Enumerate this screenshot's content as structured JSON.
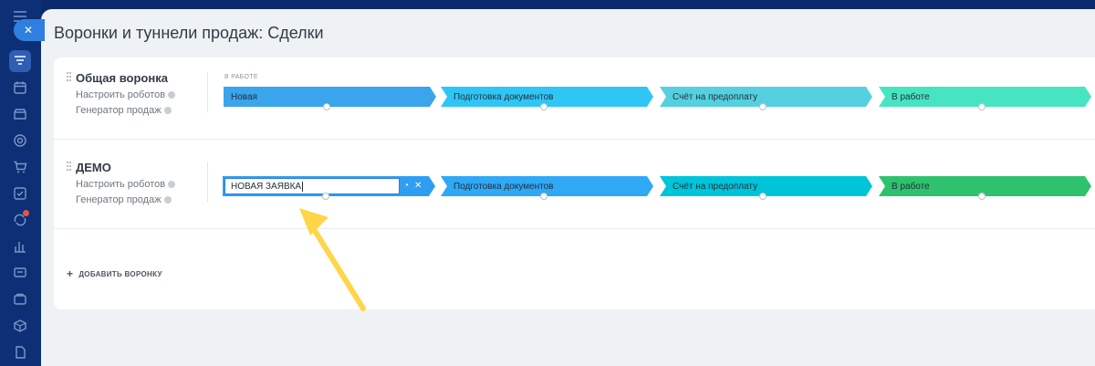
{
  "page": {
    "title": "Воронки и туннели продаж: Сделки"
  },
  "sidebar": {
    "items": [
      {
        "icon": "filter-icon",
        "active": true
      },
      {
        "icon": "calendar-icon"
      },
      {
        "icon": "store-icon"
      },
      {
        "icon": "target-icon"
      },
      {
        "icon": "cart-icon"
      },
      {
        "icon": "checkbox-icon"
      },
      {
        "icon": "automation-icon",
        "badge": true
      },
      {
        "icon": "analytics-icon"
      },
      {
        "icon": "contact-center-icon"
      },
      {
        "icon": "sites-icon"
      },
      {
        "icon": "box-icon"
      },
      {
        "icon": "document-icon"
      }
    ]
  },
  "funnels": [
    {
      "name": "Общая воронка",
      "robots_link": "Настроить роботов",
      "generator_link": "Генератор продаж",
      "group_label": "В РАБОТЕ",
      "stages": [
        {
          "label": "Новая",
          "color": "#3aa4ec"
        },
        {
          "label": "Подготовка документов",
          "color": "#2fc6f6"
        },
        {
          "label": "Счёт на предоплату",
          "color": "#55d0e0"
        },
        {
          "label": "В работе",
          "color": "#47e4c2"
        }
      ]
    },
    {
      "name": "ДЕМО",
      "robots_link": "Настроить роботов",
      "generator_link": "Генератор продаж",
      "edit_value": "НОВАЯ ЗАЯВКА",
      "edit_buttons": {
        "color_icon": "palette-icon",
        "close_icon": "close-icon"
      },
      "stages": [
        {
          "label": "Подготовка документов",
          "color": "#2fa8f6"
        },
        {
          "label": "Счёт на предоплату",
          "color": "#00c4d9"
        },
        {
          "label": "В работе",
          "color": "#2fc26e"
        }
      ]
    }
  ],
  "actions": {
    "add_funnel": "ДОБАВИТЬ ВОРОНКУ"
  },
  "annotation": {
    "arrow_color": "#ffd54a"
  }
}
